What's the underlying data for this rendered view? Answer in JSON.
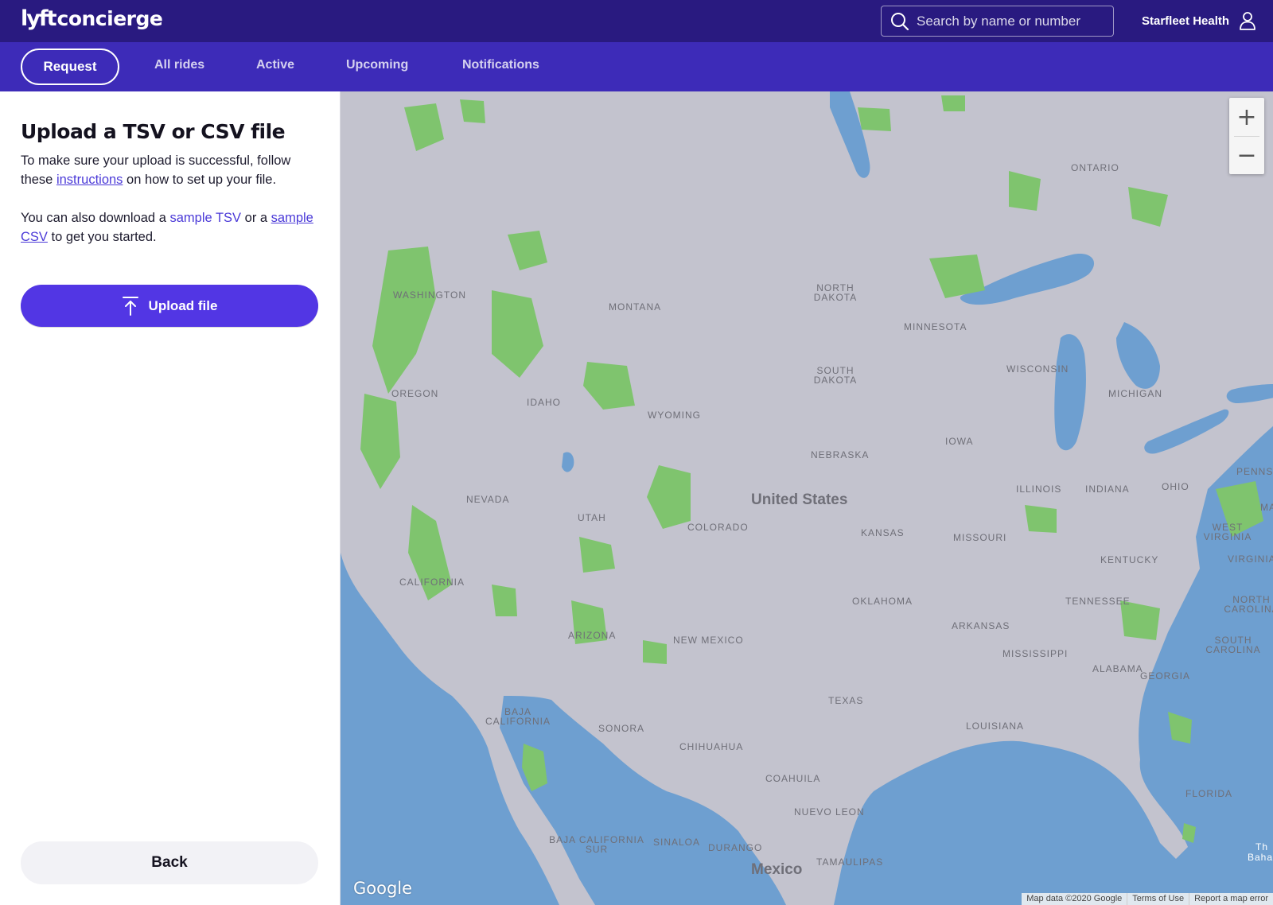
{
  "header": {
    "logo_mark": "lyft",
    "logo_text": "concierge",
    "search_placeholder": "Search by name or number",
    "account_name": "Starfleet Health"
  },
  "nav": {
    "request": "Request",
    "tabs": [
      "All rides",
      "Active",
      "Upcoming",
      "Notifications"
    ]
  },
  "panel": {
    "title": "Upload a TSV or CSV file",
    "instructions_prefix": "To make sure your upload is successful, follow these",
    "instructions_link": "instructions",
    "instructions_suffix": "on how to set up your file.",
    "sample_prefix": "You can also download a",
    "sample_tsv_link": "sample TSV",
    "sample_middle": "or a",
    "sample_csv_link": "sample CSV",
    "sample_suffix": "to get you started.",
    "upload_label": "Upload file",
    "back_label": "Back"
  },
  "map": {
    "country": "United States",
    "mexico": "Mexico",
    "states": {
      "washington": "WASHINGTON",
      "oregon": "OREGON",
      "california": "CALIFORNIA",
      "nevada": "NEVADA",
      "idaho": "IDAHO",
      "montana": "MONTANA",
      "wyoming": "WYOMING",
      "utah": "UTAH",
      "arizona": "ARIZONA",
      "colorado": "COLORADO",
      "new_mexico": "NEW MEXICO",
      "north_dakota": "NORTH DAKOTA",
      "south_dakota": "SOUTH DAKOTA",
      "nebraska": "NEBRASKA",
      "kansas": "KANSAS",
      "oklahoma": "OKLAHOMA",
      "texas": "TEXAS",
      "minnesota": "MINNESOTA",
      "iowa": "IOWA",
      "missouri": "MISSOURI",
      "arkansas": "ARKANSAS",
      "louisiana": "LOUISIANA",
      "wisconsin": "WISCONSIN",
      "illinois": "ILLINOIS",
      "michigan": "MICHIGAN",
      "indiana": "INDIANA",
      "ohio": "OHIO",
      "kentucky": "KENTUCKY",
      "tennessee": "TENNESSEE",
      "mississippi": "MISSISSIPPI",
      "alabama": "ALABAMA",
      "georgia": "GEORGIA",
      "florida": "FLORIDA",
      "south_carolina": "SOUTH CAROLINA",
      "north_carolina": "NORTH CAROLINA",
      "west_virginia": "WEST VIRGINIA",
      "virginia": "VIRGINIA",
      "ontario": "ONTARIO",
      "pennsylvania_cut": "PENNS",
      "ma_cut": "MA",
      "baja_california": "BAJA CALIFORNIA",
      "sonora": "SONORA",
      "chihuahua": "CHIHUAHUA",
      "coahuila": "COAHUILA",
      "nuevo_leon": "NUEVO LEON",
      "tamaulipas": "TAMAULIPAS",
      "sinaloa": "SINALOA",
      "durango": "DURANGO",
      "baja_california_sur": "BAJA CALIFORNIA SUR",
      "bahamas_cut": "Baha",
      "the_cut": "Th"
    },
    "zoom_in": "+",
    "zoom_out": "−",
    "google": "Google",
    "map_data": "Map data ©2020 Google",
    "terms": "Terms of Use",
    "report": "Report a map error"
  },
  "colors": {
    "header_bg": "#291a80",
    "nav_bg": "#3d2bb8",
    "accent": "#5236e4",
    "link": "#4b3ad8",
    "land": "#c3c3ce",
    "water": "#6e9fd0",
    "parks": "#7fc46e"
  }
}
